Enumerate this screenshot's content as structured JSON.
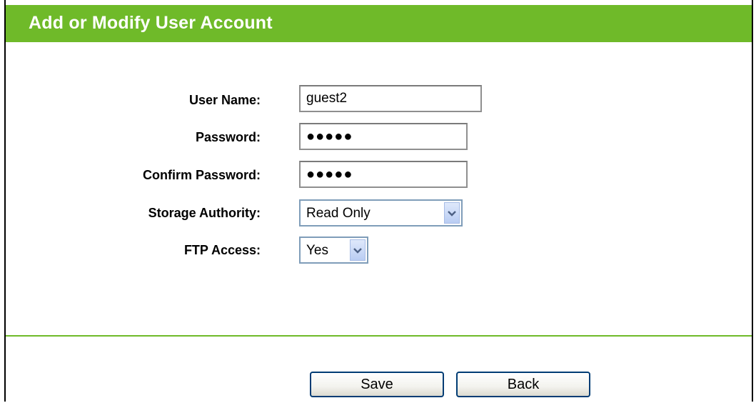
{
  "header": {
    "title": "Add or Modify User Account"
  },
  "form": {
    "user_name": {
      "label": "User Name:",
      "value": "guest2"
    },
    "password": {
      "label": "Password:",
      "value": "●●●●●"
    },
    "confirm_password": {
      "label": "Confirm Password:",
      "value": "●●●●●"
    },
    "storage_authority": {
      "label": "Storage Authority:",
      "selected": "Read Only"
    },
    "ftp_access": {
      "label": "FTP Access:",
      "selected": "Yes"
    }
  },
  "buttons": {
    "save_label": "Save",
    "back_label": "Back"
  },
  "colors": {
    "accent": "#6fba29"
  }
}
